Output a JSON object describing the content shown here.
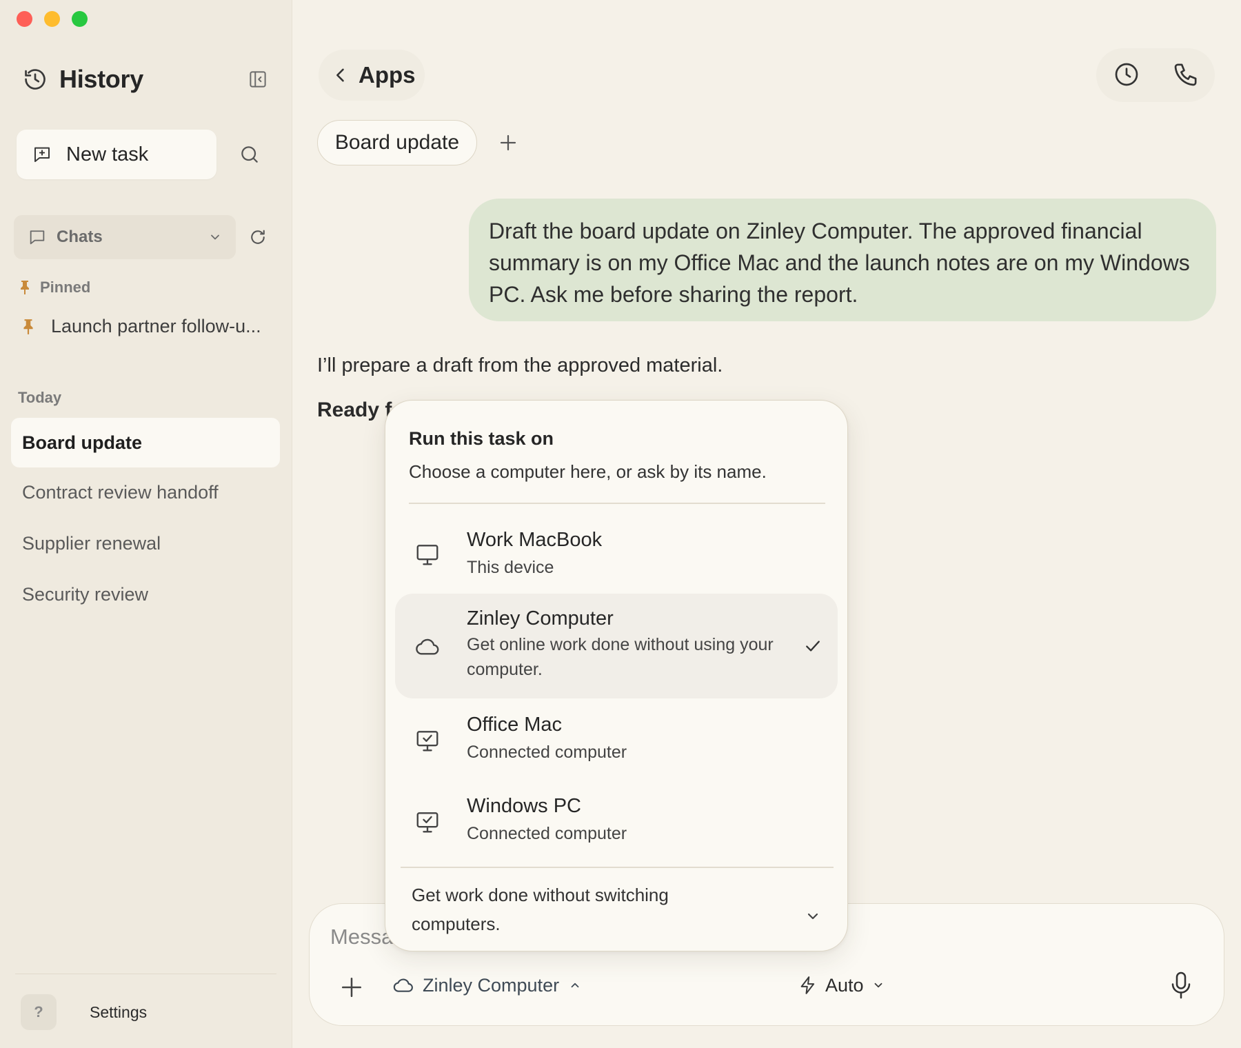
{
  "sidebar": {
    "title": "History",
    "new_task_label": "New task",
    "chats_filter_label": "Chats",
    "pinned_label": "Pinned",
    "pinned_items": [
      "Launch partner follow-u..."
    ],
    "today_label": "Today",
    "items": [
      "Board update",
      "Contract review handoff",
      "Supplier renewal",
      "Security review"
    ],
    "active_item": "Board update",
    "settings_avatar": "?",
    "settings_label": "Settings"
  },
  "header": {
    "back_label": "Apps"
  },
  "tabs": [
    "Board update"
  ],
  "conversation": {
    "user_message": "Draft the board update on Zinley Computer. The approved financial summary is on my Office Mac and the launch notes are on my Windows PC. Ask me before sharing the report.",
    "assistant_text": "I’ll prepare a draft from the approved material.",
    "assistant_heading_partial": "Ready f"
  },
  "composer": {
    "placeholder_partial": "Messa",
    "target_label": "Zinley Computer",
    "mode_label": "Auto"
  },
  "run_menu": {
    "title": "Run this task on",
    "subtitle": "Choose a computer here, or ask by its name.",
    "options": [
      {
        "name": "Work MacBook",
        "description": "This device",
        "icon": "monitor-icon",
        "selected": false
      },
      {
        "name": "Zinley Computer",
        "description": "Get online work done without using your computer.",
        "icon": "cloud-icon",
        "selected": true
      },
      {
        "name": "Office Mac",
        "description": "Connected computer",
        "icon": "monitor-check-icon",
        "selected": false
      },
      {
        "name": "Windows PC",
        "description": "Connected computer",
        "icon": "monitor-check-icon",
        "selected": false
      }
    ],
    "footer": "Get work done without switching computers."
  },
  "colors": {
    "app_background": "#f5f1e8",
    "sidebar_background": "#efeadf",
    "user_bubble": "#dde6d2",
    "pin_accent": "#c98a3a",
    "selected_option": "#f1eee8"
  }
}
